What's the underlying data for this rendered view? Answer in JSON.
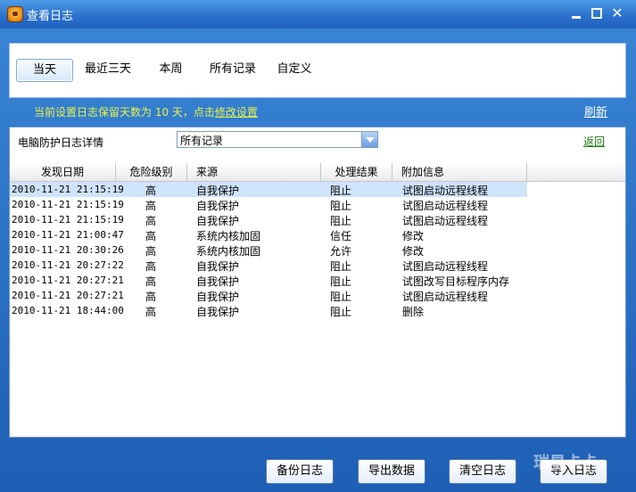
{
  "window": {
    "title": "查看日志"
  },
  "tabs": [
    {
      "label": "当天",
      "active": true
    },
    {
      "label": "最近三天",
      "active": false
    },
    {
      "label": "本周",
      "active": false
    },
    {
      "label": "所有记录",
      "active": false
    },
    {
      "label": "自定义",
      "active": false
    }
  ],
  "notice": {
    "text": "当前设置日志保留天数为 10 天，点击",
    "link": "修改设置"
  },
  "refresh_label": "刷新",
  "filter": {
    "label": "电脑防护日志详情",
    "selected": "所有记录"
  },
  "back_label": "返回",
  "table": {
    "columns": [
      "发现日期",
      "危险级别",
      "来源",
      "处理结果",
      "附加信息"
    ],
    "rows": [
      {
        "date": "2010-11-21 21:15:19",
        "level": "高",
        "source": "自我保护",
        "result": "阻止",
        "extra": "试图启动远程线程",
        "selected": true
      },
      {
        "date": "2010-11-21 21:15:19",
        "level": "高",
        "source": "自我保护",
        "result": "阻止",
        "extra": "试图启动远程线程"
      },
      {
        "date": "2010-11-21 21:15:19",
        "level": "高",
        "source": "自我保护",
        "result": "阻止",
        "extra": "试图启动远程线程"
      },
      {
        "date": "2010-11-21 21:00:47",
        "level": "高",
        "source": "系统内核加固",
        "result": "信任",
        "extra": "修改"
      },
      {
        "date": "2010-11-21 20:30:26",
        "level": "高",
        "source": "系统内核加固",
        "result": "允许",
        "extra": "修改"
      },
      {
        "date": "2010-11-21 20:27:22",
        "level": "高",
        "source": "自我保护",
        "result": "阻止",
        "extra": "试图启动远程线程"
      },
      {
        "date": "2010-11-21 20:27:21",
        "level": "高",
        "source": "自我保护",
        "result": "阻止",
        "extra": "试图改写目标程序内存"
      },
      {
        "date": "2010-11-21 20:27:21",
        "level": "高",
        "source": "自我保护",
        "result": "阻止",
        "extra": "试图启动远程线程"
      },
      {
        "date": "2010-11-21 18:44:00",
        "level": "高",
        "source": "自我保护",
        "result": "阻止",
        "extra": "删除"
      }
    ]
  },
  "footer": {
    "backup": "备份日志",
    "export": "导出数据",
    "clear": "清空日志",
    "import": "导入日志"
  },
  "watermark": "瑞星卡卡"
}
